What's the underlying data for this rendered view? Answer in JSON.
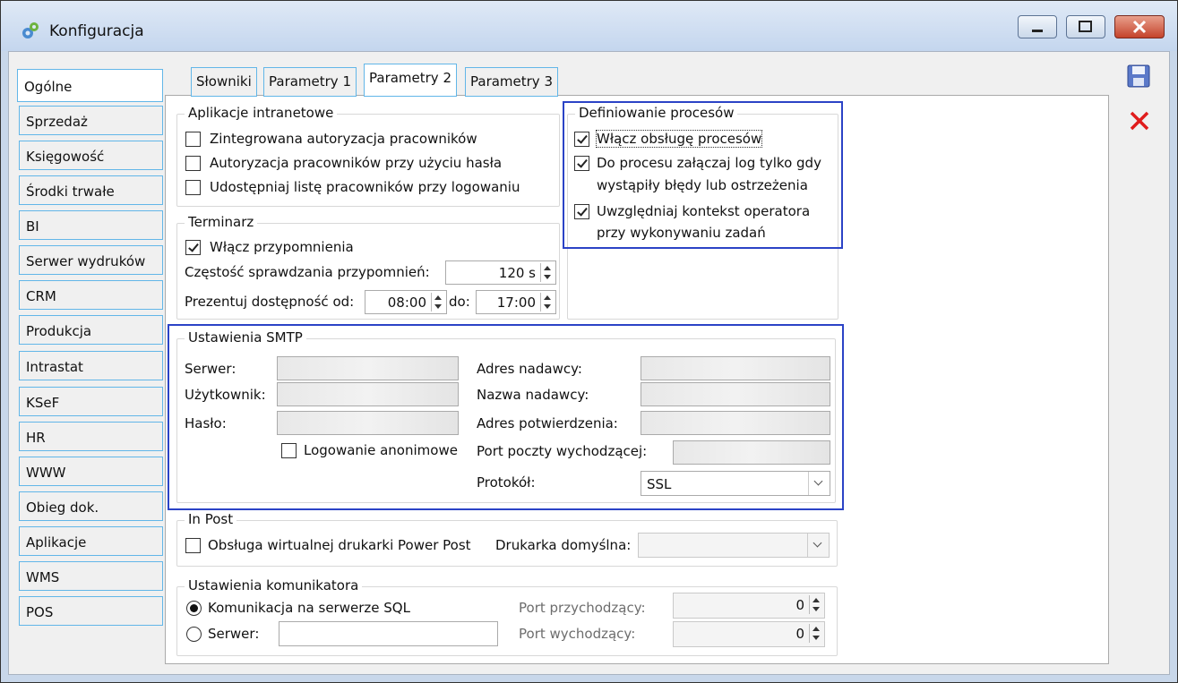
{
  "window": {
    "title": "Konfiguracja"
  },
  "nav": [
    "Ogólne",
    "Sprzedaż",
    "Księgowość",
    "Środki trwałe",
    "BI",
    "Serwer wydruków",
    "CRM",
    "Produkcja",
    "Intrastat",
    "KSeF",
    "HR",
    "WWW",
    "Obieg dok.",
    "Aplikacje",
    "WMS",
    "POS"
  ],
  "tabs": [
    "Słowniki",
    "Parametry 1",
    "Parametry 2",
    "Parametry 3"
  ],
  "intranet": {
    "legend": "Aplikacje intranetowe",
    "opt1": "Zintegrowana autoryzacja pracowników",
    "opt2": "Autoryzacja pracowników przy użyciu hasła",
    "opt3": "Udostępniaj listę pracowników przy logowaniu"
  },
  "process": {
    "legend": "Definiowanie procesów",
    "opt1": "Włącz obsługę procesów",
    "opt2_line1": "Do procesu załączaj log tylko gdy",
    "opt2_line2": "wystąpiły błędy lub ostrzeżenia",
    "opt3_line1": "Uwzględniaj kontekst operatora",
    "opt3_line2": "przy wykonywaniu zadań"
  },
  "terminarz": {
    "legend": "Terminarz",
    "reminders": "Włącz przypomnienia",
    "freq_label": "Częstość sprawdzania przypomnień:",
    "freq_value": "120 s",
    "avail_label": "Prezentuj dostępność od:",
    "from": "08:00",
    "to_label": "do:",
    "to": "17:00"
  },
  "smtp": {
    "legend": "Ustawienia SMTP",
    "server": "Serwer:",
    "user": "Użytkownik:",
    "password": "Hasło:",
    "anonymous": "Logowanie anonimowe",
    "sender_addr": "Adres nadawcy:",
    "sender_name": "Nazwa nadawcy:",
    "confirm_addr": "Adres potwierdzenia:",
    "port_label": "Port poczty wychodzącej:",
    "protocol_label": "Protokół:",
    "protocol_value": "SSL"
  },
  "inpost": {
    "legend": "In Post",
    "virtual_printer": "Obsługa wirtualnej drukarki Power Post",
    "default_printer": "Drukarka domyślna:"
  },
  "comm": {
    "legend": "Ustawienia komunikatora",
    "sql": "Komunikacja na serwerze SQL",
    "server": "Serwer:",
    "port_in_label": "Port przychodzący:",
    "port_in": "0",
    "port_out_label": "Port wychodzący:",
    "port_out": "0"
  },
  "colors": {
    "highlight_border": "#2b43c6",
    "nav_border": "#62b6e8",
    "close_button": "#c4432b"
  }
}
